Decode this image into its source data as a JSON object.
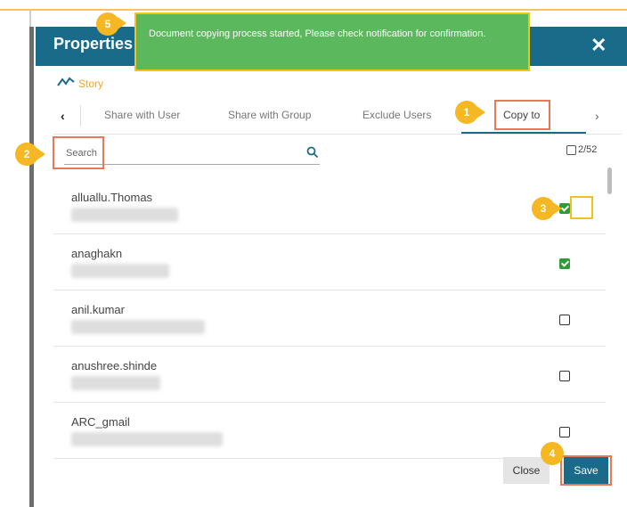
{
  "dialog": {
    "title": "Properties",
    "close_icon": "close-icon",
    "story_icon": "line-chart-icon",
    "story_label": "Story"
  },
  "tabs": {
    "prev_label": "‹",
    "next_label": "›",
    "items": [
      {
        "label": "Share with User"
      },
      {
        "label": "Share with Group"
      },
      {
        "label": "Exclude Users"
      },
      {
        "label": "Copy to",
        "active": true
      }
    ]
  },
  "search": {
    "placeholder": "Search",
    "icon": "search-icon"
  },
  "selection": {
    "count": "2/52"
  },
  "users": [
    {
      "name": "alluallu.Thomas",
      "checked": true
    },
    {
      "name": "anaghakn",
      "checked": true
    },
    {
      "name": "anil.kumar",
      "checked": false
    },
    {
      "name": "anushree.shinde",
      "checked": false
    },
    {
      "name": "ARC_gmail",
      "checked": false
    }
  ],
  "buttons": {
    "close_label": "Close",
    "save_label": "Save"
  },
  "toast": {
    "message": "Document copying process started, Please check notification for confirmation."
  },
  "callouts": [
    "1",
    "2",
    "3",
    "4",
    "5"
  ],
  "colors": {
    "header": "#1a6a89",
    "accent": "#f5a623",
    "checked": "#2f9a3a",
    "toast": "#5cb85c",
    "highlight": "#e8785a",
    "callout": "#f5b722"
  }
}
